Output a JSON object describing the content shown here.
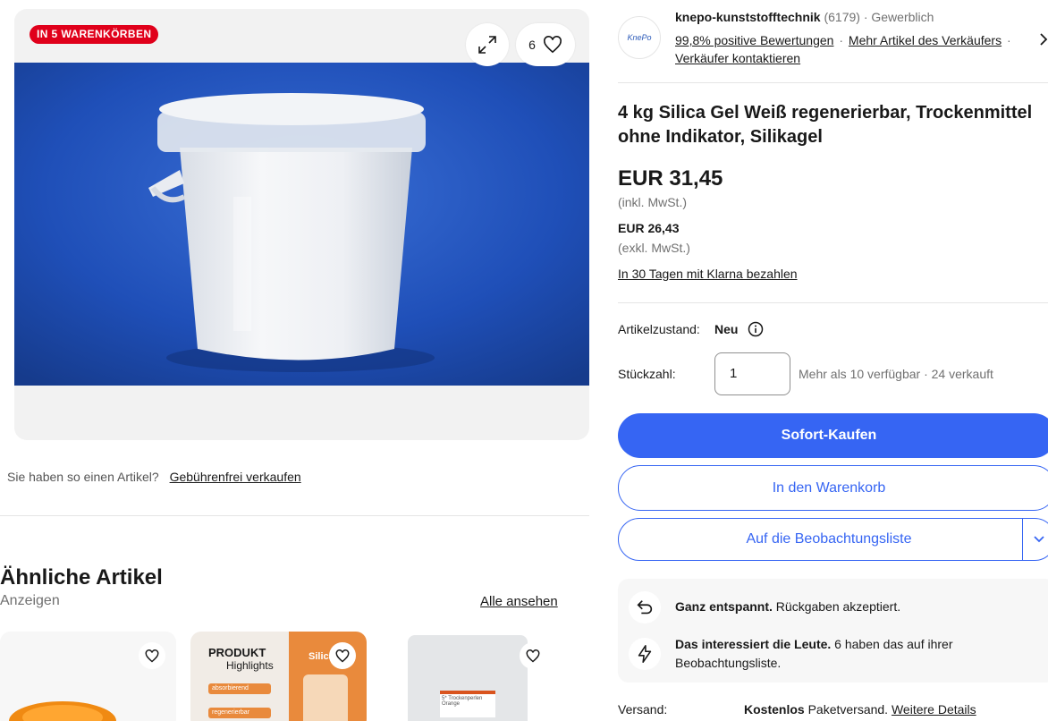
{
  "gallery": {
    "badge": "IN 5 WARENKÖRBEN",
    "watch_count": "6",
    "image_alt": "Eimer mit weißem Silica Gel"
  },
  "sell": {
    "question": "Sie haben so einen Artikel?",
    "link": "Gebührenfrei verkaufen"
  },
  "similar": {
    "title": "Ähnliche Artikel",
    "subtitle": "Anzeigen",
    "see_all": "Alle ansehen",
    "cards": [
      {
        "name": "orange-silica"
      },
      {
        "name": "produkt-highlights",
        "heading": "PRODUKT",
        "sub": "Highlights",
        "pill1": "absorbierend",
        "pill2": "regenerierbar",
        "tag": "Silica"
      },
      {
        "name": "silica-bag",
        "bag_label": "5* Trockenperlen Orange"
      }
    ]
  },
  "seller": {
    "logo_text": "KnePo",
    "name": "knepo-kunststofftechnik",
    "rating_count": "(6179)",
    "type": "· Gewerblich",
    "positive": "99,8% positive Bewertungen",
    "more_items": "Mehr Artikel des Verkäufers",
    "contact": "Verkäufer kontaktieren"
  },
  "item": {
    "title": "4 kg Silica Gel Weiß regenerierbar, Trockenmittel ohne Indikator, Silikagel",
    "price": "EUR 31,45",
    "price_note": "(inkl. MwSt.)",
    "price_net": "EUR 26,43",
    "price_net_note": "(exkl. MwSt.)",
    "klarna": "In 30 Tagen mit Klarna bezahlen",
    "condition_label": "Artikelzustand:",
    "condition_value": "Neu",
    "quantity_label": "Stückzahl:",
    "quantity_value": "1",
    "availability": "Mehr als 10 verfügbar · 24 verkauft"
  },
  "buttons": {
    "buy_now": "Sofort-Kaufen",
    "add_to_cart": "In den Warenkorb",
    "watchlist": "Auf die Beobachtungsliste"
  },
  "info": {
    "returns_bold": "Ganz entspannt.",
    "returns_text": " Rückgaben akzeptiert.",
    "interest_bold": "Das interessiert die Leute.",
    "interest_text": " 6 haben das auf ihrer Beobachtungsliste."
  },
  "shipping": {
    "label": "Versand:",
    "bold": "Kostenlos",
    "text": " Paketversand.",
    "link": "Weitere Details"
  },
  "colors": {
    "accent": "#3665f3",
    "badge": "#e0001b",
    "photo_bg": "#1f4fb8"
  }
}
